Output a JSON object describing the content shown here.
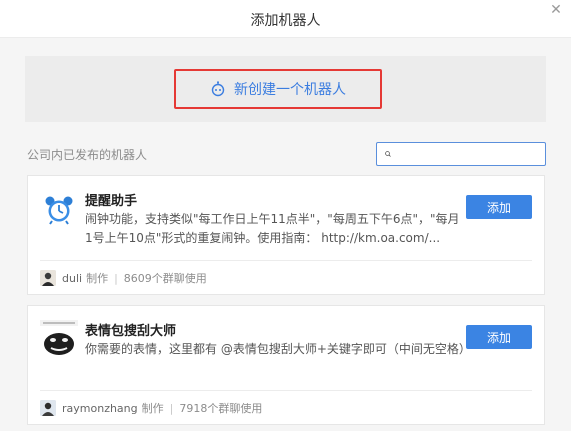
{
  "dialog": {
    "title": "添加机器人",
    "close_icon": "close-icon"
  },
  "create": {
    "label": "新创建一个机器人",
    "icon": "robot-icon"
  },
  "list": {
    "section_label": "公司内已发布的机器人",
    "search_placeholder": "",
    "search_icon": "search-icon"
  },
  "bots": [
    {
      "name": "提醒助手",
      "description": "闹钟功能，支持类似\"每工作日上午11点半\"，\"每周五下午6点\"，\"每月1号上午10点\"形式的重复闹钟。使用指南： http://km.oa.com/...",
      "add_label": "添加",
      "author": "duli",
      "made_by": "制作",
      "usage": "8609个群聊使用",
      "icon": "alarm-clock-icon"
    },
    {
      "name": "表情包搜刮大师",
      "description": "你需要的表情，这里都有 @表情包搜刮大师+关键字即可（中间无空格）",
      "add_label": "添加",
      "author": "raymonzhang",
      "made_by": "制作",
      "usage": "7918个群聊使用",
      "icon": "meme-image-icon"
    }
  ]
}
